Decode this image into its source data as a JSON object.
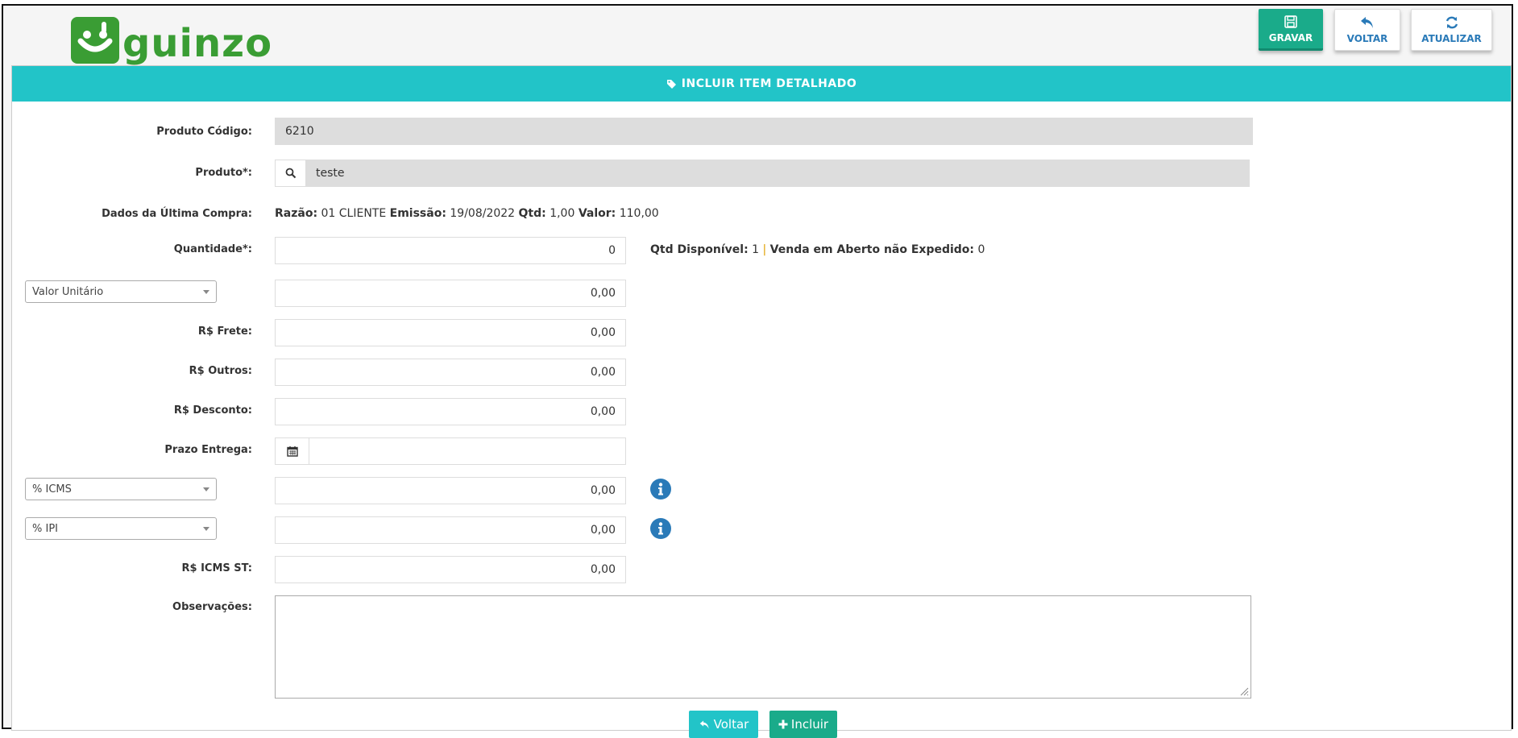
{
  "brand": {
    "name": "guinzo",
    "color": "#3a9d34"
  },
  "toolbar": {
    "gravar": "GRAVAR",
    "voltar": "VOLTAR",
    "atualizar": "ATUALIZAR"
  },
  "panel": {
    "title": "INCLUIR ITEM DETALHADO",
    "accent": "#22c4c8"
  },
  "form": {
    "produto_codigo": {
      "label": "Produto Código:",
      "value": "6210"
    },
    "produto": {
      "label": "Produto*:",
      "value": "teste"
    },
    "ultima_compra": {
      "label": "Dados da Última Compra:",
      "razao_label": "Razão:",
      "razao": "01 CLIENTE",
      "emissao_label": "Emissão:",
      "emissao": "19/08/2022",
      "qtd_label": "Qtd:",
      "qtd": "1,00",
      "valor_label": "Valor:",
      "valor": "110,00"
    },
    "quantidade": {
      "label": "Quantidade*:",
      "value": "0"
    },
    "disponivel": {
      "qtd_label": "Qtd Disponível:",
      "qtd": "1",
      "separator": "|",
      "venda_label": "Venda em Aberto não Expedido:",
      "venda": "0"
    },
    "valor_unitario": {
      "select": "Valor Unitário",
      "value": "0,00"
    },
    "frete": {
      "label": "R$ Frete:",
      "value": "0,00"
    },
    "outros": {
      "label": "R$ Outros:",
      "value": "0,00"
    },
    "desconto": {
      "label": "R$ Desconto:",
      "value": "0,00"
    },
    "prazo_entrega": {
      "label": "Prazo Entrega:",
      "value": ""
    },
    "icms": {
      "select": "% ICMS",
      "value": "0,00"
    },
    "ipi": {
      "select": "% IPI",
      "value": "0,00"
    },
    "icms_st": {
      "label": "R$ ICMS ST:",
      "value": "0,00"
    },
    "observacoes": {
      "label": "Observações:",
      "value": ""
    }
  },
  "actions": {
    "voltar": "Voltar",
    "incluir": "Incluir"
  },
  "icons": {
    "gravar": "floppy-disk-icon",
    "voltar": "reply-arrow-icon",
    "atualizar": "refresh-icon",
    "header": "tag-icon",
    "search": "search-icon",
    "calendar": "calendar-icon",
    "info": "info-circle-icon",
    "plus": "plus-icon"
  }
}
